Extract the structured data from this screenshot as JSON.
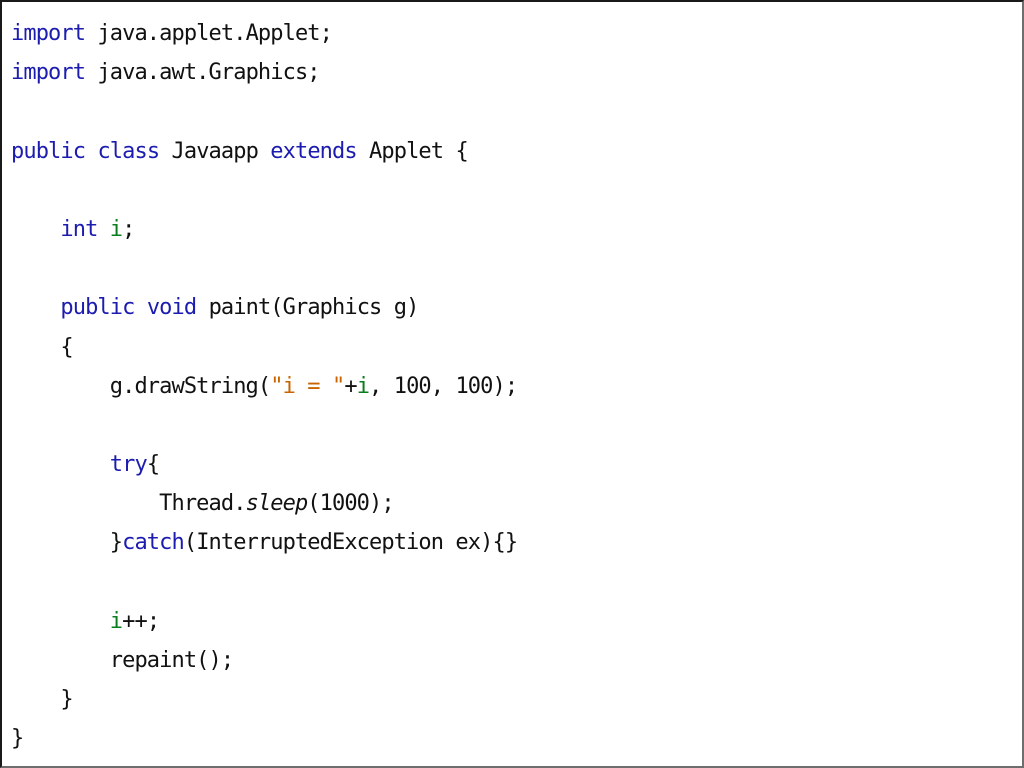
{
  "editor": {
    "colors": {
      "keyword": "#1c1cb0",
      "string": "#c96400",
      "field": "#0a7d1c",
      "text": "#111111",
      "background": "#ffffff"
    },
    "lines": [
      [
        {
          "t": "import",
          "c": "kw"
        },
        {
          "t": " java.applet.Applet;"
        }
      ],
      [
        {
          "t": "import",
          "c": "kw"
        },
        {
          "t": " java.awt.Graphics;"
        }
      ],
      [],
      [
        {
          "t": "public",
          "c": "kw"
        },
        {
          "t": " "
        },
        {
          "t": "class",
          "c": "kw"
        },
        {
          "t": " Javaapp "
        },
        {
          "t": "extends",
          "c": "kw"
        },
        {
          "t": " Applet {"
        }
      ],
      [],
      [
        {
          "t": "    "
        },
        {
          "t": "int",
          "c": "kw"
        },
        {
          "t": " "
        },
        {
          "t": "i",
          "c": "var"
        },
        {
          "t": ";"
        }
      ],
      [],
      [
        {
          "t": "    "
        },
        {
          "t": "public",
          "c": "kw"
        },
        {
          "t": " "
        },
        {
          "t": "void",
          "c": "kw"
        },
        {
          "t": " paint(Graphics g)"
        }
      ],
      [
        {
          "t": "    {"
        }
      ],
      [
        {
          "t": "        g.drawString("
        },
        {
          "t": "\"i = \"",
          "c": "str"
        },
        {
          "t": "+"
        },
        {
          "t": "i",
          "c": "var"
        },
        {
          "t": ", 100, 100);"
        }
      ],
      [],
      [
        {
          "t": "        "
        },
        {
          "t": "try",
          "c": "kw"
        },
        {
          "t": "{"
        }
      ],
      [
        {
          "t": "            Thread."
        },
        {
          "t": "sleep",
          "c": "it"
        },
        {
          "t": "(1000);"
        }
      ],
      [
        {
          "t": "        }"
        },
        {
          "t": "catch",
          "c": "kw"
        },
        {
          "t": "(InterruptedException ex){}"
        }
      ],
      [],
      [
        {
          "t": "        "
        },
        {
          "t": "i",
          "c": "var"
        },
        {
          "t": "++;"
        }
      ],
      [
        {
          "t": "        repaint();"
        }
      ],
      [
        {
          "t": "    }"
        }
      ],
      [
        {
          "t": "}"
        }
      ]
    ]
  }
}
